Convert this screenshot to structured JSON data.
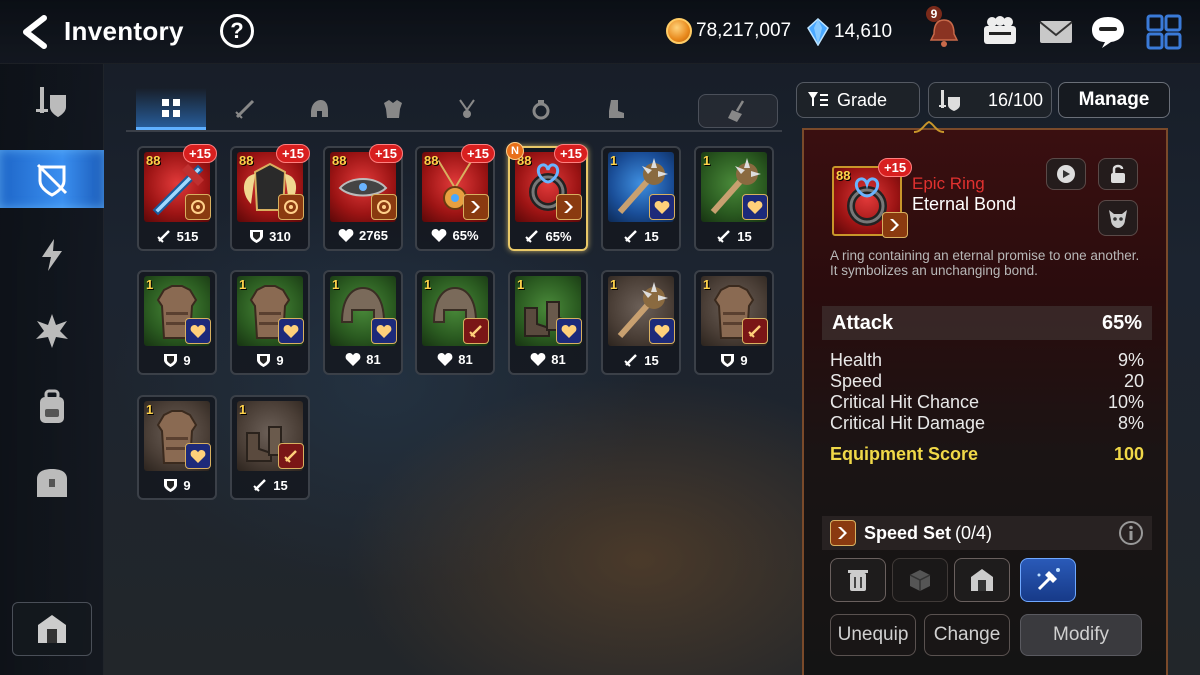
{
  "header": {
    "title": "Inventory",
    "gold": "78,217,007",
    "crystals": "14,610",
    "notification_count": "9"
  },
  "tabs": [
    "all",
    "weapon",
    "helmet",
    "armor",
    "necklace",
    "ring",
    "boots"
  ],
  "controls": {
    "grade_label": "Grade",
    "capacity": "16/100",
    "manage_label": "Manage"
  },
  "items": [
    {
      "level": "88",
      "enhance": "+15",
      "stat": "515",
      "stat_icon": "attack",
      "art": "weapon",
      "bg": "red",
      "set": "orange"
    },
    {
      "level": "88",
      "enhance": "+15",
      "stat": "310",
      "stat_icon": "defense",
      "art": "armor-wing",
      "bg": "red",
      "set": "orange"
    },
    {
      "level": "88",
      "enhance": "+15",
      "stat": "2765",
      "stat_icon": "health",
      "art": "helmet",
      "bg": "red",
      "set": "orange"
    },
    {
      "level": "88",
      "enhance": "+15",
      "stat": "65%",
      "stat_icon": "health",
      "art": "necklace",
      "bg": "red",
      "set": "orange-speed"
    },
    {
      "level": "88",
      "enhance": "+15",
      "stat": "65%",
      "stat_icon": "attack",
      "art": "ring",
      "bg": "red",
      "set": "orange-speed",
      "new": "N",
      "selected": true
    },
    {
      "level": "1",
      "enhance": "",
      "stat": "15",
      "stat_icon": "attack",
      "art": "club",
      "bg": "blue",
      "set": "navy"
    },
    {
      "level": "1",
      "enhance": "",
      "stat": "15",
      "stat_icon": "attack",
      "art": "club",
      "bg": "green",
      "set": "navy"
    },
    {
      "level": "1",
      "enhance": "",
      "stat": "9",
      "stat_icon": "defense",
      "art": "vest",
      "bg": "green",
      "set": "navy"
    },
    {
      "level": "1",
      "enhance": "",
      "stat": "9",
      "stat_icon": "defense",
      "art": "vest",
      "bg": "green",
      "set": "navy"
    },
    {
      "level": "1",
      "enhance": "",
      "stat": "81",
      "stat_icon": "health",
      "art": "helmet-plain",
      "bg": "green",
      "set": "navy"
    },
    {
      "level": "1",
      "enhance": "",
      "stat": "81",
      "stat_icon": "health",
      "art": "helmet-plain",
      "bg": "green",
      "set": "crimson"
    },
    {
      "level": "1",
      "enhance": "",
      "stat": "81",
      "stat_icon": "health",
      "art": "boots",
      "bg": "green",
      "set": "navy"
    },
    {
      "level": "1",
      "enhance": "",
      "stat": "15",
      "stat_icon": "attack",
      "art": "club",
      "bg": "grey",
      "set": "navy"
    },
    {
      "level": "1",
      "enhance": "",
      "stat": "9",
      "stat_icon": "defense",
      "art": "vest",
      "bg": "grey",
      "set": "crimson"
    },
    {
      "level": "1",
      "enhance": "",
      "stat": "9",
      "stat_icon": "defense",
      "art": "vest",
      "bg": "grey",
      "set": "navy"
    },
    {
      "level": "1",
      "enhance": "",
      "stat": "15",
      "stat_icon": "attack",
      "art": "boots",
      "bg": "grey",
      "set": "crimson"
    }
  ],
  "detail": {
    "level": "88",
    "enhance": "+15",
    "grade": "Epic Ring",
    "name": "Eternal Bond",
    "description_line1": "A ring containing an eternal promise to one another.",
    "description_line2": "It symbolizes an unchanging bond.",
    "main_stat_label": "Attack",
    "main_stat_value": "65%",
    "substats": [
      {
        "label": "Health",
        "value": "9%"
      },
      {
        "label": "Speed",
        "value": "20"
      },
      {
        "label": "Critical Hit Chance",
        "value": "10%"
      },
      {
        "label": "Critical Hit Damage",
        "value": "8%"
      }
    ],
    "score_label": "Equipment Score",
    "score_value": "100",
    "set_name": "Speed Set",
    "set_progress": "(0/4)",
    "buttons": {
      "unequip": "Unequip",
      "change": "Change",
      "modify": "Modify"
    }
  },
  "colors": {
    "grade_epic": "#e0312f",
    "score": "#f0d848",
    "active_tab": "#3a8ff0"
  }
}
